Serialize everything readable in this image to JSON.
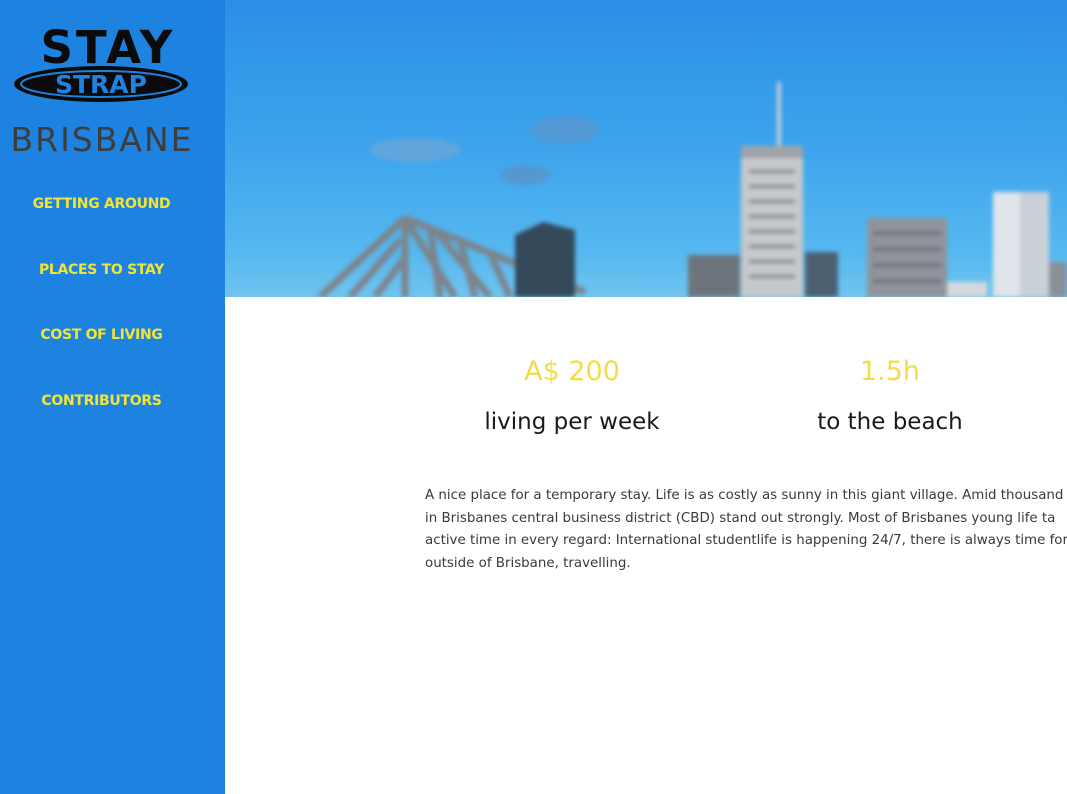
{
  "logo": {
    "line1": "STAY",
    "line2": "STRAP"
  },
  "city": "BRISBANE",
  "nav": [
    {
      "label": "GETTING AROUND"
    },
    {
      "label": "PLACES TO STAY"
    },
    {
      "label": "COST OF LIVING"
    },
    {
      "label": "CONTRIBUTORS"
    }
  ],
  "stats": [
    {
      "value": "A$ 200",
      "label": "living per week"
    },
    {
      "value": "1.5h",
      "label": "to the beach"
    }
  ],
  "description": {
    "lines": [
      "A nice place for a temporary stay. Life is as costly as sunny in this giant village. Amid thousand",
      "in Brisbanes central business district (CBD) stand out strongly. Most of Brisbanes young life ta",
      "active time in every regard: International studentlife is happening 24/7, there is always time for",
      "outside of Brisbane, travelling."
    ]
  },
  "colors": {
    "sidebar": "#1e83e0",
    "nav_text": "#f2e634",
    "stat_value": "#f3dc4b",
    "city_text": "#3d3d3d"
  },
  "icons": {
    "hero": "brisbane-skyline-image"
  }
}
